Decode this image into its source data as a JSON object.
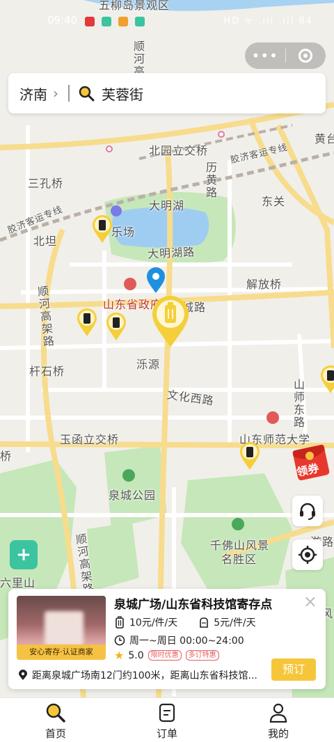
{
  "status_bar": {
    "time": "09:40",
    "right": "HD ᯤ .ıll .ıll 84"
  },
  "capsule": {
    "more": "•••"
  },
  "search": {
    "city": "济南",
    "chevron": "›",
    "query": "芙蓉街"
  },
  "map_labels": [
    {
      "text": "五柳岛景观区"
    },
    {
      "text": "顺河高"
    },
    {
      "text": "北园立交桥"
    },
    {
      "text": "胶济客运专线"
    },
    {
      "text": "黄台"
    },
    {
      "text": "三孔桥"
    },
    {
      "text": "历黄路"
    },
    {
      "text": "大明湖"
    },
    {
      "text": "东关"
    },
    {
      "text": "胶济客运专线"
    },
    {
      "text": "乐场"
    },
    {
      "text": "北坦"
    },
    {
      "text": "大明湖路"
    },
    {
      "text": "解放桥"
    },
    {
      "text": "山东省政府"
    },
    {
      "text": "城路"
    },
    {
      "text": "顺河高架路"
    },
    {
      "text": "泺源"
    },
    {
      "text": "杆石桥"
    },
    {
      "text": "文化西路"
    },
    {
      "text": "山师东路"
    },
    {
      "text": "山东师范大学"
    },
    {
      "text": "玉函立交桥"
    },
    {
      "text": "桥"
    },
    {
      "text": "泉城公园"
    },
    {
      "text": "千佛山风景"
    },
    {
      "text": "名胜区"
    },
    {
      "text": "顺河高架路"
    },
    {
      "text": "游路"
    },
    {
      "text": "六里山"
    },
    {
      "text": "风景"
    }
  ],
  "icons": {
    "storage_pin": "luggage-pin-icon",
    "location": "location-pin-icon",
    "service": "headset-icon",
    "locate": "locate-icon",
    "coupon": "red-envelope-icon",
    "shield": "shield-plus-icon"
  },
  "colors": {
    "accent": "#f6c63a",
    "pin": "#f5cf3a",
    "location": "#1e90e0",
    "park": "#c6e7b9",
    "water": "#9fcdf1",
    "road_major": "#f9e3a0"
  },
  "coupon": {
    "label": "领券"
  },
  "card": {
    "badge": "安心寄存·认证商家",
    "title": "泉城广场/山东省科技馆寄存点",
    "price_large": "10元/件/天",
    "price_small": "5元/件/天",
    "hours": "周一~周日 00:00~24:00",
    "rating": "5.0",
    "tags": [
      "限时优惠",
      "多订特惠"
    ],
    "distance": "距离泉城广场南12门约100米，距离山东省科技馆...",
    "close": "×",
    "reserve": "预订"
  },
  "tabs": [
    {
      "label": "首页",
      "icon": "search-icon"
    },
    {
      "label": "订单",
      "icon": "order-icon"
    },
    {
      "label": "我的",
      "icon": "person-icon"
    }
  ]
}
